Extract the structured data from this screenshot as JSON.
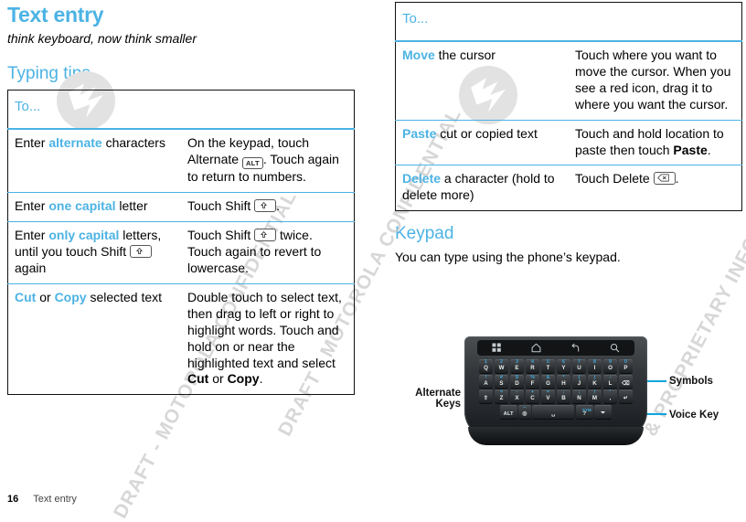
{
  "page": {
    "title": "Text entry",
    "subtitle": "think keyboard, now think smaller",
    "footer_page_number": "16",
    "footer_section": "Text entry",
    "accent_color": "#4cb3e4",
    "callout_color": "#0aa5e0"
  },
  "watermark": {
    "line_1": "DRAFT - MOTOROLA CONFIDENTIAL",
    "line_2": "& PROPRIETARY INFORMATION",
    "line_3": "DRAFT - MOTOROLA CONFIDENTIAL"
  },
  "typing_tips": {
    "heading": "Typing tips",
    "column_header": "To...",
    "rows": [
      {
        "task_prefix": "Enter ",
        "task_highlight": "alternate",
        "task_suffix": " characters",
        "action_parts": [
          {
            "type": "text",
            "value": "On the keypad, touch Alternate "
          },
          {
            "type": "keycap",
            "value": "ALT",
            "icon": "alt-key-icon"
          },
          {
            "type": "text",
            "value": ". Touch again to return to numbers."
          }
        ]
      },
      {
        "task_prefix": "Enter ",
        "task_highlight": "one capital",
        "task_suffix": " letter",
        "action_parts": [
          {
            "type": "text",
            "value": "Touch Shift "
          },
          {
            "type": "keycap",
            "value": "",
            "icon": "shift-key-icon"
          },
          {
            "type": "text",
            "value": "."
          }
        ]
      },
      {
        "task_prefix": "Enter ",
        "task_highlight": "only capital",
        "task_suffix": " letters, until you touch Shift ",
        "task_keycap": "shift-key-icon",
        "task_tail": " again",
        "action_parts": [
          {
            "type": "text",
            "value": "Touch Shift "
          },
          {
            "type": "keycap",
            "value": "",
            "icon": "shift-key-icon"
          },
          {
            "type": "text",
            "value": " twice. Touch again to revert to lowercase."
          }
        ]
      },
      {
        "task_prefix": "",
        "task_highlight": "Cut",
        "task_mid": " or ",
        "task_highlight_2": "Copy",
        "task_suffix": " selected text",
        "action_parts": [
          {
            "type": "text",
            "value": "Double touch to select text, then drag to left or right to highlight words. Touch and hold on or near the highlighted text and select "
          },
          {
            "type": "bold",
            "value": "Cut"
          },
          {
            "type": "text",
            "value": " or "
          },
          {
            "type": "bold",
            "value": "Copy"
          },
          {
            "type": "text",
            "value": "."
          }
        ]
      }
    ]
  },
  "cursor_tips": {
    "column_header": "To...",
    "rows": [
      {
        "task_highlight": "Move",
        "task_suffix": " the cursor",
        "action_parts": [
          {
            "type": "text",
            "value": "Touch where you want to move the cursor. When you see a red icon, drag it to where you want the cursor."
          }
        ]
      },
      {
        "task_highlight": "Paste",
        "task_suffix": " cut or copied text",
        "action_parts": [
          {
            "type": "text",
            "value": "Touch and hold location to paste then touch "
          },
          {
            "type": "bold",
            "value": "Paste"
          },
          {
            "type": "text",
            "value": "."
          }
        ]
      },
      {
        "task_highlight": "Delete",
        "task_suffix": " a character (hold to delete more)",
        "action_parts": [
          {
            "type": "text",
            "value": "Touch Delete "
          },
          {
            "type": "keycap",
            "value": "",
            "icon": "delete-key-icon"
          },
          {
            "type": "text",
            "value": "."
          }
        ]
      }
    ]
  },
  "keypad_section": {
    "heading": "Keypad",
    "body": "You can type using the phone’s keypad.",
    "callouts": {
      "alternate_keys": "Alternate\nKeys",
      "alternate_keys_line1": "Alternate",
      "alternate_keys_line2": "Keys",
      "symbols": "Symbols",
      "voice_key": "Voice Key"
    },
    "phone": {
      "nav_icons": [
        "apps-grid-icon",
        "home-icon",
        "back-icon",
        "search-icon"
      ],
      "keyboard_rows": [
        [
          {
            "main": "Q",
            "alt": "1"
          },
          {
            "main": "W",
            "alt": "2"
          },
          {
            "main": "E",
            "alt": "3"
          },
          {
            "main": "R",
            "alt": "4"
          },
          {
            "main": "T",
            "alt": "5"
          },
          {
            "main": "Y",
            "alt": "6"
          },
          {
            "main": "U",
            "alt": "7"
          },
          {
            "main": "I",
            "alt": "8"
          },
          {
            "main": "O",
            "alt": "9"
          },
          {
            "main": "P",
            "alt": "0"
          }
        ],
        [
          {
            "main": "A",
            "alt": "!"
          },
          {
            "main": "S",
            "alt": "#"
          },
          {
            "main": "D",
            "alt": "$"
          },
          {
            "main": "F",
            "alt": "%"
          },
          {
            "main": "G",
            "alt": "&"
          },
          {
            "main": "H",
            "alt": "*"
          },
          {
            "main": "J",
            "alt": "("
          },
          {
            "main": "K",
            "alt": ")"
          },
          {
            "main": "L",
            "alt": "‑"
          },
          {
            "main": "⌫",
            "alt": ""
          }
        ],
        [
          {
            "main": "⇧",
            "alt": ""
          },
          {
            "main": "Z",
            "alt": "="
          },
          {
            "main": "X",
            "alt": "-"
          },
          {
            "main": "C",
            "alt": "+"
          },
          {
            "main": "V",
            "alt": "="
          },
          {
            "main": "B",
            "alt": ":"
          },
          {
            "main": "N",
            "alt": ";"
          },
          {
            "main": "M",
            "alt": "/"
          },
          {
            "main": ",",
            "alt": "\""
          },
          {
            "main": "↵",
            "alt": ""
          }
        ],
        [
          {
            "main": "ALT",
            "alt": ""
          },
          {
            "main": "◎",
            "alt": "–"
          },
          {
            "main": "␣",
            "alt": ""
          },
          {
            "main": "?",
            "alt": "SYM"
          },
          {
            "main": "⏷",
            "alt": ""
          }
        ]
      ]
    }
  }
}
